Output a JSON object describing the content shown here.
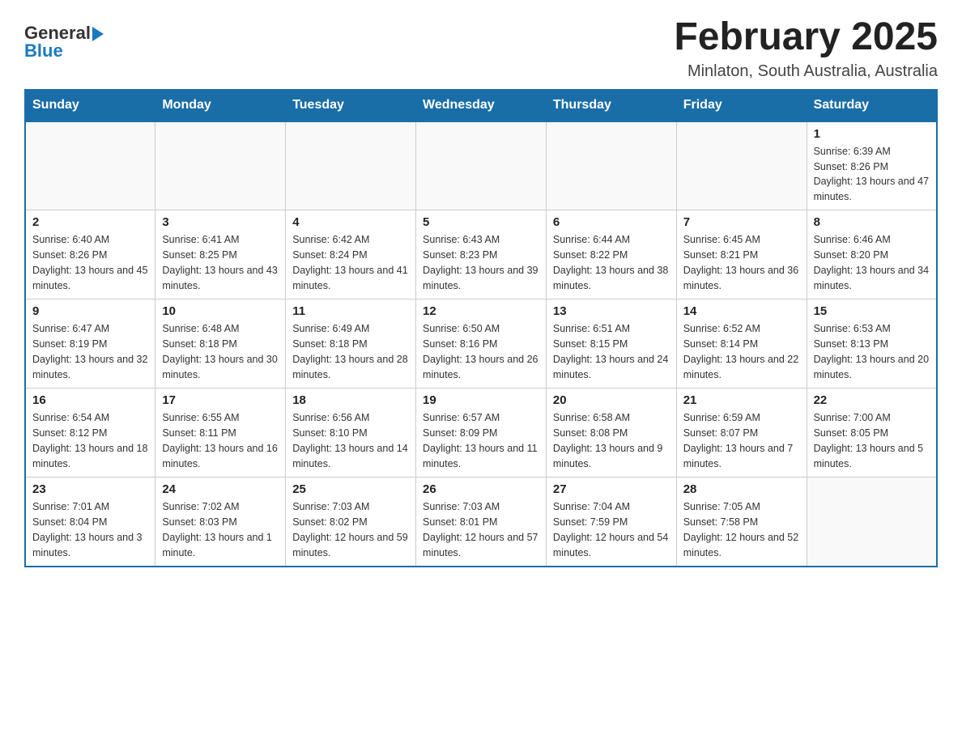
{
  "header": {
    "title": "February 2025",
    "subtitle": "Minlaton, South Australia, Australia",
    "logo_general": "General",
    "logo_blue": "Blue"
  },
  "days_of_week": [
    "Sunday",
    "Monday",
    "Tuesday",
    "Wednesday",
    "Thursday",
    "Friday",
    "Saturday"
  ],
  "weeks": [
    [
      {
        "day": "",
        "info": ""
      },
      {
        "day": "",
        "info": ""
      },
      {
        "day": "",
        "info": ""
      },
      {
        "day": "",
        "info": ""
      },
      {
        "day": "",
        "info": ""
      },
      {
        "day": "",
        "info": ""
      },
      {
        "day": "1",
        "info": "Sunrise: 6:39 AM\nSunset: 8:26 PM\nDaylight: 13 hours and 47 minutes."
      }
    ],
    [
      {
        "day": "2",
        "info": "Sunrise: 6:40 AM\nSunset: 8:26 PM\nDaylight: 13 hours and 45 minutes."
      },
      {
        "day": "3",
        "info": "Sunrise: 6:41 AM\nSunset: 8:25 PM\nDaylight: 13 hours and 43 minutes."
      },
      {
        "day": "4",
        "info": "Sunrise: 6:42 AM\nSunset: 8:24 PM\nDaylight: 13 hours and 41 minutes."
      },
      {
        "day": "5",
        "info": "Sunrise: 6:43 AM\nSunset: 8:23 PM\nDaylight: 13 hours and 39 minutes."
      },
      {
        "day": "6",
        "info": "Sunrise: 6:44 AM\nSunset: 8:22 PM\nDaylight: 13 hours and 38 minutes."
      },
      {
        "day": "7",
        "info": "Sunrise: 6:45 AM\nSunset: 8:21 PM\nDaylight: 13 hours and 36 minutes."
      },
      {
        "day": "8",
        "info": "Sunrise: 6:46 AM\nSunset: 8:20 PM\nDaylight: 13 hours and 34 minutes."
      }
    ],
    [
      {
        "day": "9",
        "info": "Sunrise: 6:47 AM\nSunset: 8:19 PM\nDaylight: 13 hours and 32 minutes."
      },
      {
        "day": "10",
        "info": "Sunrise: 6:48 AM\nSunset: 8:18 PM\nDaylight: 13 hours and 30 minutes."
      },
      {
        "day": "11",
        "info": "Sunrise: 6:49 AM\nSunset: 8:18 PM\nDaylight: 13 hours and 28 minutes."
      },
      {
        "day": "12",
        "info": "Sunrise: 6:50 AM\nSunset: 8:16 PM\nDaylight: 13 hours and 26 minutes."
      },
      {
        "day": "13",
        "info": "Sunrise: 6:51 AM\nSunset: 8:15 PM\nDaylight: 13 hours and 24 minutes."
      },
      {
        "day": "14",
        "info": "Sunrise: 6:52 AM\nSunset: 8:14 PM\nDaylight: 13 hours and 22 minutes."
      },
      {
        "day": "15",
        "info": "Sunrise: 6:53 AM\nSunset: 8:13 PM\nDaylight: 13 hours and 20 minutes."
      }
    ],
    [
      {
        "day": "16",
        "info": "Sunrise: 6:54 AM\nSunset: 8:12 PM\nDaylight: 13 hours and 18 minutes."
      },
      {
        "day": "17",
        "info": "Sunrise: 6:55 AM\nSunset: 8:11 PM\nDaylight: 13 hours and 16 minutes."
      },
      {
        "day": "18",
        "info": "Sunrise: 6:56 AM\nSunset: 8:10 PM\nDaylight: 13 hours and 14 minutes."
      },
      {
        "day": "19",
        "info": "Sunrise: 6:57 AM\nSunset: 8:09 PM\nDaylight: 13 hours and 11 minutes."
      },
      {
        "day": "20",
        "info": "Sunrise: 6:58 AM\nSunset: 8:08 PM\nDaylight: 13 hours and 9 minutes."
      },
      {
        "day": "21",
        "info": "Sunrise: 6:59 AM\nSunset: 8:07 PM\nDaylight: 13 hours and 7 minutes."
      },
      {
        "day": "22",
        "info": "Sunrise: 7:00 AM\nSunset: 8:05 PM\nDaylight: 13 hours and 5 minutes."
      }
    ],
    [
      {
        "day": "23",
        "info": "Sunrise: 7:01 AM\nSunset: 8:04 PM\nDaylight: 13 hours and 3 minutes."
      },
      {
        "day": "24",
        "info": "Sunrise: 7:02 AM\nSunset: 8:03 PM\nDaylight: 13 hours and 1 minute."
      },
      {
        "day": "25",
        "info": "Sunrise: 7:03 AM\nSunset: 8:02 PM\nDaylight: 12 hours and 59 minutes."
      },
      {
        "day": "26",
        "info": "Sunrise: 7:03 AM\nSunset: 8:01 PM\nDaylight: 12 hours and 57 minutes."
      },
      {
        "day": "27",
        "info": "Sunrise: 7:04 AM\nSunset: 7:59 PM\nDaylight: 12 hours and 54 minutes."
      },
      {
        "day": "28",
        "info": "Sunrise: 7:05 AM\nSunset: 7:58 PM\nDaylight: 12 hours and 52 minutes."
      },
      {
        "day": "",
        "info": ""
      }
    ]
  ]
}
